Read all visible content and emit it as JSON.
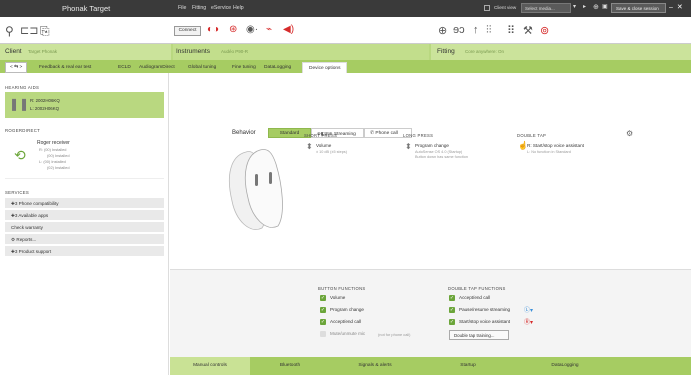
{
  "app": {
    "title": "Phonak Target"
  },
  "menu": [
    "File",
    "Fitting",
    "eService",
    "Help"
  ],
  "titlebar": {
    "client_view_label": "Client view",
    "select_media": "Select media...",
    "save_close": "Save & close session",
    "window_controls": "– ✕"
  },
  "toolbar": {
    "connect_label": "Connect"
  },
  "header": {
    "client_label": "Client",
    "client_name": "Target Phonak",
    "instruments_label": "Instruments",
    "instruments_value": "Audéo P90-R",
    "fitting_label": "Fitting",
    "fitting_value": "Core anywhere: On"
  },
  "tabs": [
    {
      "label": "< ⇆ >"
    },
    {
      "label": "Feedback & real ear test"
    },
    {
      "label": "ECLD"
    },
    {
      "label": "AudiogramDirect"
    },
    {
      "label": "Global tuning"
    },
    {
      "label": "Fine tuning"
    },
    {
      "label": "DataLogging"
    },
    {
      "label": "Device options"
    }
  ],
  "left": {
    "hearing_aids_title": "HEARING AIDS",
    "ha_right": "R: 2002H06KQ",
    "ha_left": "L: 2002H06KQ",
    "roger_title": "ROGERDIRECT",
    "roger_name": "Roger receiver",
    "roger_lines": [
      "R: (00) Installed",
      "(00) Installed",
      "L: (00) Installed",
      "(02) Installed"
    ],
    "services_title": "SERVICES",
    "services": [
      "✚3 Phone compatibility",
      "✚3 Available apps",
      "Check warranty",
      "⚙ Reports...",
      "✚3 Product support"
    ]
  },
  "main": {
    "behavior_label": "Behavior",
    "mode_tabs": [
      "Standard",
      "Streaming",
      "Phone call"
    ],
    "mode_tab_icons": "⊕◧⊞⊕",
    "short_press_title": "SHORT PRESS",
    "short_press_value": "Volume",
    "short_press_note": "± 10 dB (±5 steps)",
    "long_press_title": "LONG PRESS",
    "long_press_value": "Program change",
    "long_press_note1": "AutoSense OS 4.0 (Startup)",
    "long_press_note2": "Button down has same function",
    "double_tap_title": "DOUBLE TAP",
    "double_tap_r": "R: Start/stop voice assistant",
    "double_tap_l": "L: No function in Standard"
  },
  "button_functions": {
    "title": "BUTTON FUNCTIONS",
    "items": [
      {
        "label": "Volume",
        "checked": true
      },
      {
        "label": "Program change",
        "checked": true
      },
      {
        "label": "Accept/end call",
        "checked": true
      },
      {
        "label": "Mute/unmute mic",
        "checked": false
      }
    ],
    "mute_note": "(not for phone call)"
  },
  "double_tap_functions": {
    "title": "DOUBLE TAP FUNCTIONS",
    "items": [
      {
        "label": "Accept/end call",
        "checked": true
      },
      {
        "label": "Pause/resume streaming",
        "checked": true
      },
      {
        "label": "Start/stop voice assistant",
        "checked": true
      }
    ],
    "training_button": "Double tap training..."
  },
  "bottom_tabs": [
    "Manual controls",
    "Bluetooth",
    "Signals & alerts",
    "Startup",
    "DataLogging"
  ],
  "colors": {
    "green": "#a6cc62",
    "light_green": "#b9d880",
    "accent_red": "#d62b2b",
    "check_green": "#6ba539"
  }
}
